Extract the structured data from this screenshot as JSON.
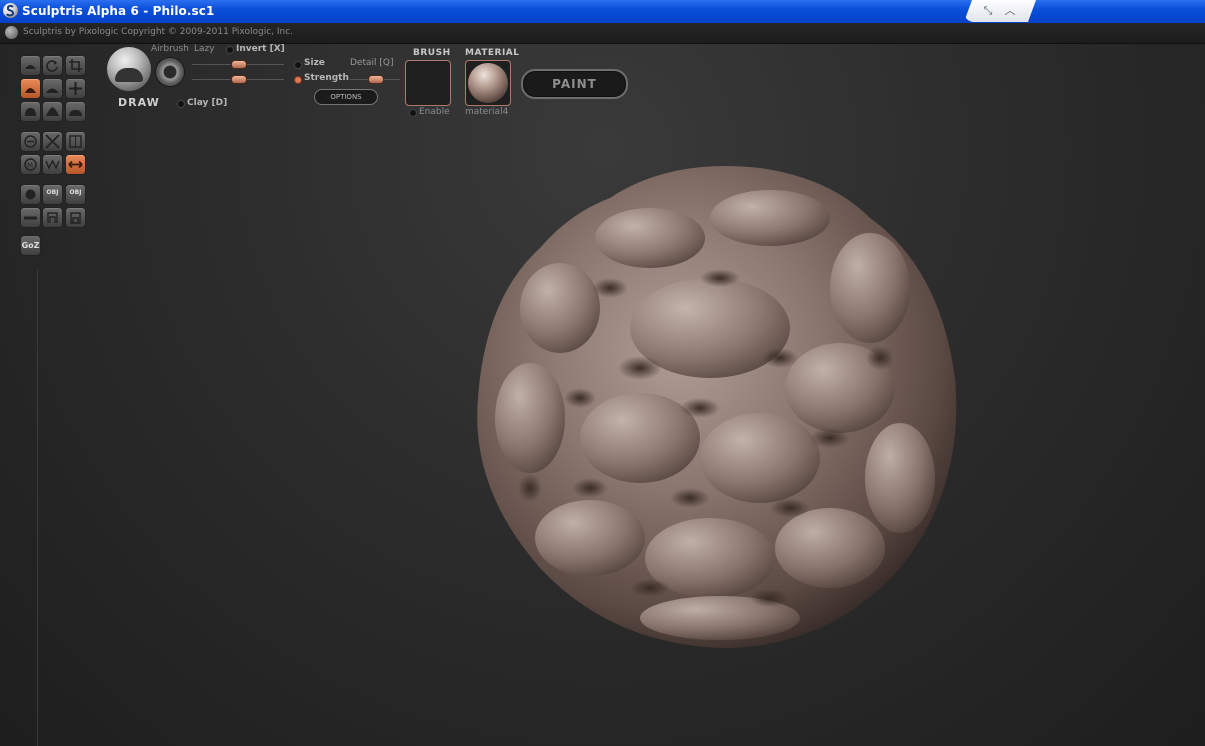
{
  "window": {
    "title": "Sculptris Alpha 6 - Philo.sc1"
  },
  "app": {
    "credit": "Sculptris by Pixologic   Copyright © 2009-2011 Pixologic, Inc."
  },
  "brush_panel": {
    "tool_name": "DRAW",
    "airbrush_label": "Airbrush",
    "lazy_label": "Lazy",
    "invert_label": "Invert [X]",
    "size_label": "Size",
    "detail_label": "Detail [Q]",
    "strength_label": "Strength",
    "options_label": "OPTIONS",
    "clay_label": "Clay [D]"
  },
  "brush_slot": {
    "heading": "BRUSH",
    "enable_label": "Enable"
  },
  "material_slot": {
    "heading": "MATERIAL",
    "name": "material4"
  },
  "paint_button": {
    "label": "PAINT"
  },
  "left_toolbar": {
    "goz_label": "GoZ"
  },
  "colors": {
    "accent": "#e07a56",
    "titlebar": "#0b4fd8",
    "model": "#7a6660"
  }
}
